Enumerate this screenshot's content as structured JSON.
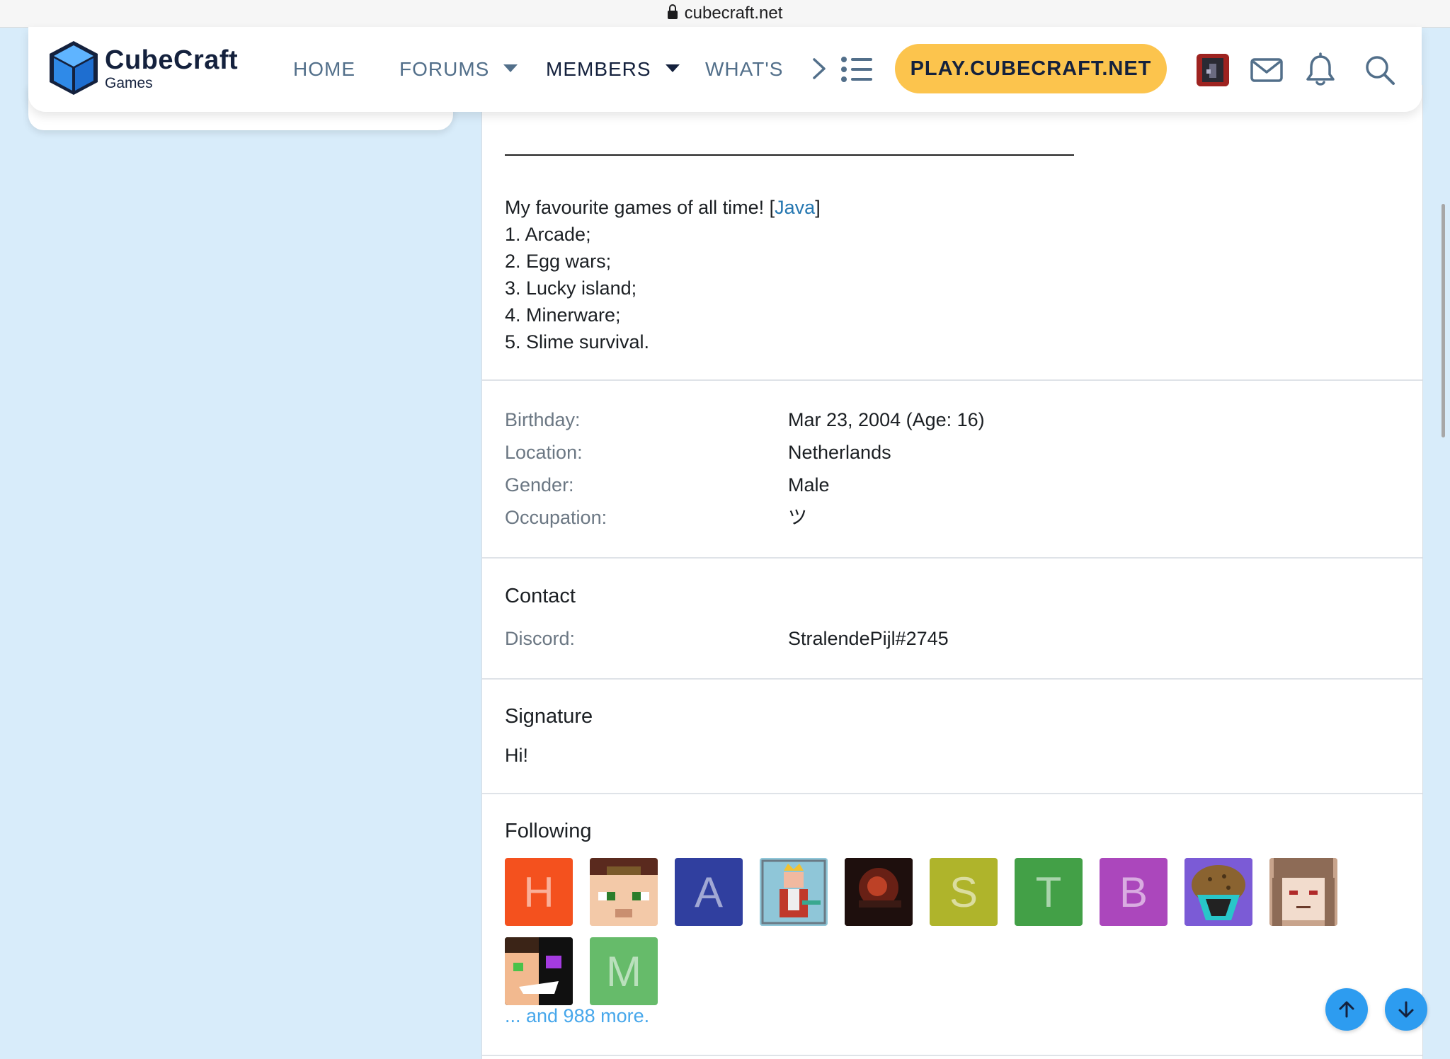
{
  "browser": {
    "url": "cubecraft.net"
  },
  "header": {
    "logo_name": "CubeCraft",
    "logo_sub": "Games",
    "nav": {
      "home": "HOME",
      "forums": "FORUMS",
      "members": "MEMBERS",
      "whats": "WHAT'S"
    },
    "play_button": "PLAY.CUBECRAFT.NET",
    "icons": [
      "chevron-right-icon",
      "list-icon",
      "mail-icon",
      "bell-icon",
      "search-icon"
    ]
  },
  "about": {
    "intro": "My favourite games of all time! [",
    "intro_link": "Java",
    "intro_end": "]",
    "games": [
      "1. Arcade;",
      "2. Egg wars;",
      "3. Lucky island;",
      "4. Minerware;",
      "5. Slime survival."
    ]
  },
  "details": [
    {
      "label": "Birthday:",
      "value": "Mar 23, 2004 (Age: 16)"
    },
    {
      "label": "Location:",
      "value": "Netherlands"
    },
    {
      "label": "Gender:",
      "value": "Male"
    },
    {
      "label": "Occupation:",
      "value": "ツ"
    }
  ],
  "contact": {
    "heading": "Contact",
    "label": "Discord:",
    "value": "StralendePijl#2745"
  },
  "signature": {
    "heading": "Signature",
    "text": "Hi!"
  },
  "following": {
    "heading": "Following",
    "avatars": [
      {
        "letter": "H",
        "color": "#f4511e"
      },
      {
        "letter": "",
        "color": "#f3c9a8"
      },
      {
        "letter": "A",
        "color": "#303f9f"
      },
      {
        "letter": "",
        "color": "#8fc6d8"
      },
      {
        "letter": "",
        "color": "#2a1512"
      },
      {
        "letter": "S",
        "color": "#afb42b"
      },
      {
        "letter": "T",
        "color": "#43a047"
      },
      {
        "letter": "B",
        "color": "#ab47bc"
      },
      {
        "letter": "",
        "color": "#7b5bd6"
      },
      {
        "letter": "",
        "color": "#c8a48c"
      },
      {
        "letter": "",
        "color": "#101010"
      },
      {
        "letter": "M",
        "color": "#66bb6a"
      }
    ],
    "more": "... and 988 more."
  }
}
